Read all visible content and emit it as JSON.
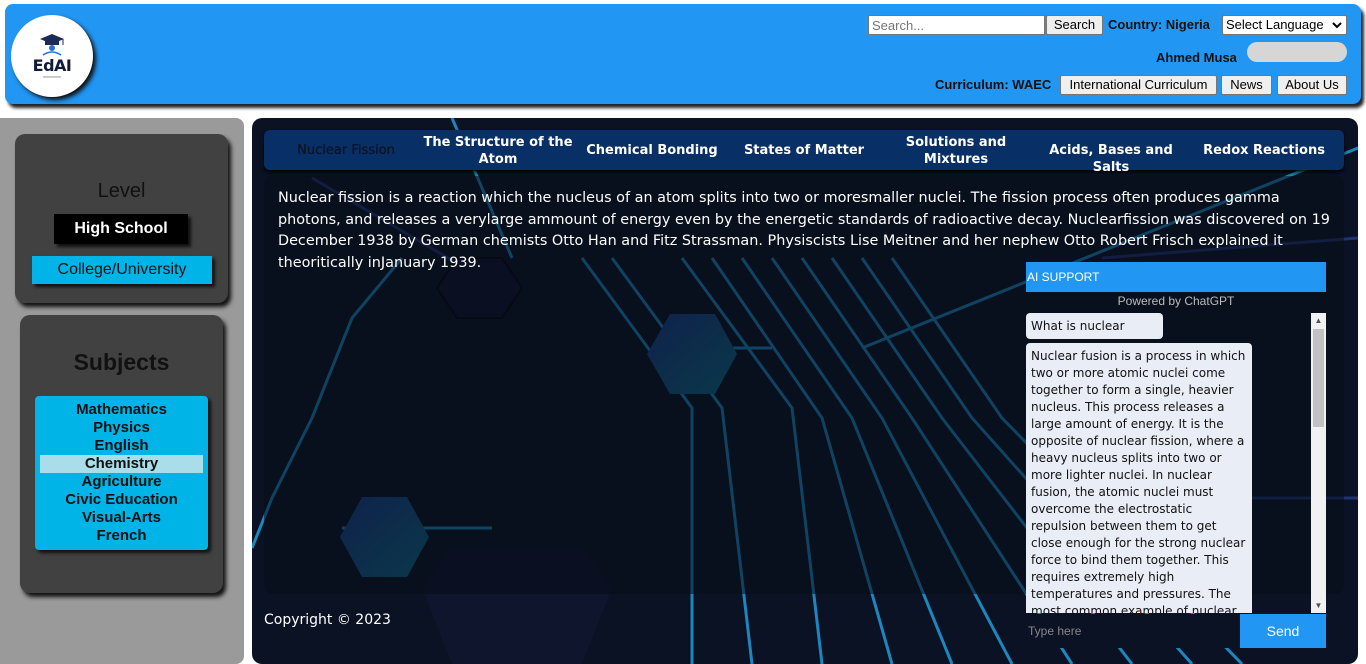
{
  "app": {
    "logo_text": "EdAI"
  },
  "header": {
    "search_placeholder": "Search...",
    "search_button": "Search",
    "country_label": "Country: Nigeria",
    "language_select": "Select Language",
    "user_name": "Ahmed Musa",
    "curriculum_label": "Curriculum: WAEC",
    "links": [
      "International Curriculum",
      "News",
      "About Us"
    ]
  },
  "sidebar": {
    "level_title": "Level",
    "levels": [
      "High School",
      "College/University"
    ],
    "active_level": "High School",
    "subjects_title": "Subjects",
    "subjects": [
      "Mathematics",
      "Physics",
      "English",
      "Chemistry",
      "Agriculture",
      "Civic Education",
      "Visual-Arts",
      "French"
    ],
    "active_subject": "Chemistry"
  },
  "topics": {
    "tabs": [
      "Nuclear Fission",
      "The Structure of the Atom",
      "Chemical Bonding",
      "States of Matter",
      "Solutions and Mixtures",
      "Acids, Bases and Salts",
      "Redox Reactions"
    ],
    "active_tab": "Nuclear Fission"
  },
  "content": {
    "paragraph": "Nuclear fission is a reaction which the nucleus of an atom splits into two or moresmaller nuclei. The fission process often produces gamma photons, and releases a verylarge ammount of energy even by the energetic standards of radioactive decay. Nuclearfission was discovered on 19 December 1938 by German chemists Otto Han and Fitz Strassman. Physiscists Lise Meitner and her nephew Otto Robert Frisch explained it theoritically inJanuary 1939."
  },
  "ai_support": {
    "title": "AI SUPPORT",
    "powered_by": "Powered by ChatGPT",
    "user_message": "What is nuclear fusion",
    "bot_message": "Nuclear fusion is a process in which two or more atomic nuclei come together to form a single, heavier nucleus. This process releases a large amount of energy. It is the opposite of nuclear fission, where a heavy nucleus splits into two or more lighter nuclei. In nuclear fusion, the atomic nuclei must overcome the electrostatic repulsion between them to get close enough for the strong nuclear force to bind them together. This requires extremely high temperatures and pressures. The most common example of nuclear fusion is the fusion of hydrogen",
    "input_placeholder": "Type here",
    "send_button": "Send"
  },
  "footer": {
    "copyright": "Copyright © 2023"
  },
  "colors": {
    "brand_blue": "#2196f3",
    "accent_cyan": "#00b4e8",
    "nav_navy": "#083066",
    "panel_grey": "#414141"
  }
}
